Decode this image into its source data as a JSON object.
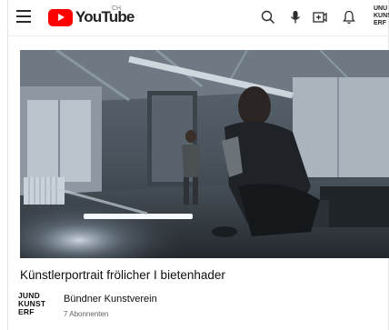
{
  "header": {
    "logo_text": "YouTube",
    "region": "CH",
    "channel_badge_lines": [
      "UNU",
      "KUNS",
      "ERF"
    ]
  },
  "video": {
    "title": "Künstlerportrait frölicher I bietenhader"
  },
  "channel": {
    "logo_lines": [
      "JUND",
      "KUNST",
      "ERF"
    ],
    "name": "Bündner Kunstverein",
    "subscribers": "7 Abonnenten"
  },
  "icons": {
    "menu": "menu-icon",
    "search": "search-icon",
    "mic": "microphone-icon",
    "create": "create-video-icon",
    "notifications": "bell-icon"
  },
  "colors": {
    "brand_red": "#ff0000",
    "text": "#0f0f0f",
    "muted": "#606060"
  }
}
